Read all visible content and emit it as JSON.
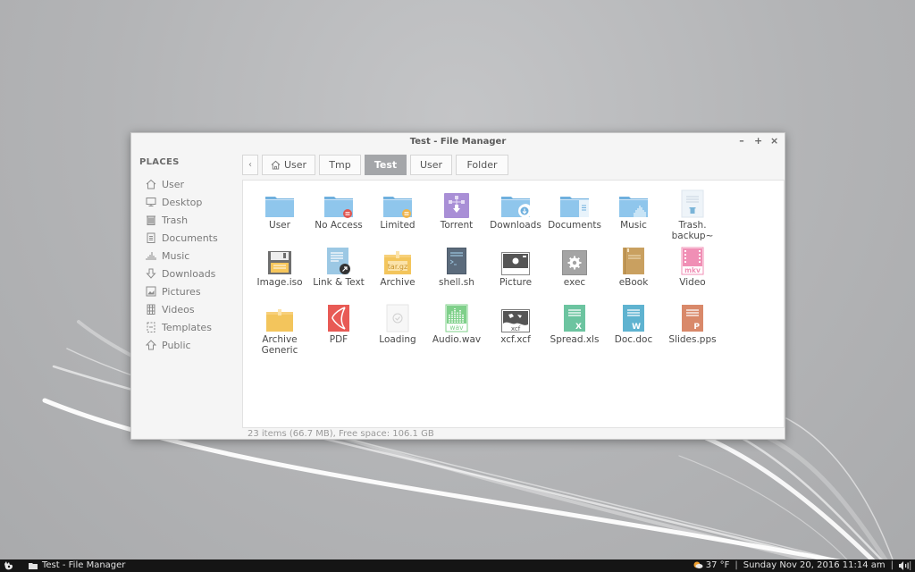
{
  "window": {
    "title": "Test - File Manager",
    "controls": {
      "minimize": "–",
      "maximize": "+",
      "close": "×"
    }
  },
  "sidebar": {
    "heading": "PLACES",
    "items": [
      {
        "label": "User",
        "icon": "home-icon"
      },
      {
        "label": "Desktop",
        "icon": "desktop-icon"
      },
      {
        "label": "Trash",
        "icon": "trash-icon"
      },
      {
        "label": "Documents",
        "icon": "documents-icon"
      },
      {
        "label": "Music",
        "icon": "music-icon"
      },
      {
        "label": "Downloads",
        "icon": "downloads-icon"
      },
      {
        "label": "Pictures",
        "icon": "pictures-icon"
      },
      {
        "label": "Videos",
        "icon": "videos-icon"
      },
      {
        "label": "Templates",
        "icon": "templates-icon"
      },
      {
        "label": "Public",
        "icon": "public-icon"
      }
    ]
  },
  "pathbar": {
    "back_label": "‹",
    "crumbs": [
      {
        "label": "User",
        "has_home_icon": true,
        "active": false
      },
      {
        "label": "Tmp",
        "active": false
      },
      {
        "label": "Test",
        "active": true
      },
      {
        "label": "User",
        "active": false
      },
      {
        "label": "Folder",
        "active": false
      }
    ]
  },
  "files": [
    {
      "name": "User",
      "type": "folder"
    },
    {
      "name": "No Access",
      "type": "folder-noaccess"
    },
    {
      "name": "Limited",
      "type": "folder-limited"
    },
    {
      "name": "Torrent",
      "type": "torrent"
    },
    {
      "name": "Downloads",
      "type": "folder-downloads"
    },
    {
      "name": "Documents",
      "type": "folder-documents"
    },
    {
      "name": "Music",
      "type": "folder-music"
    },
    {
      "name": "Trash.\nbackup~",
      "type": "backup"
    },
    {
      "name": "Image.iso",
      "type": "iso"
    },
    {
      "name": "Link & Text",
      "type": "text-link"
    },
    {
      "name": "Archive",
      "type": "archive-targz",
      "badge": "tar.gz"
    },
    {
      "name": "shell.sh",
      "type": "shell"
    },
    {
      "name": "Picture",
      "type": "picture"
    },
    {
      "name": "exec",
      "type": "exec"
    },
    {
      "name": "eBook",
      "type": "ebook"
    },
    {
      "name": "Video",
      "type": "video",
      "badge": "mkv"
    },
    {
      "name": "Archive\nGeneric",
      "type": "archive-generic"
    },
    {
      "name": "PDF",
      "type": "pdf"
    },
    {
      "name": "Loading",
      "type": "loading"
    },
    {
      "name": "Audio.wav",
      "type": "audio",
      "badge": "wav"
    },
    {
      "name": "xcf.xcf",
      "type": "xcf",
      "badge": "xcf"
    },
    {
      "name": "Spread.xls",
      "type": "spreadsheet",
      "badge": "X"
    },
    {
      "name": "Doc.doc",
      "type": "document",
      "badge": "W"
    },
    {
      "name": "Slides.pps",
      "type": "presentation",
      "badge": "P"
    }
  ],
  "status": "23 items (66.7 MB), Free space: 106.1 GB",
  "taskbar": {
    "task_title": "Test - File Manager",
    "weather": "37 °F",
    "datetime": "Sunday Nov 20, 2016 11:14 am",
    "separator": "|"
  },
  "colors": {
    "folder": "#8fc6ec",
    "folder_dark": "#6fb0de",
    "accent_active_crumb": "#a4a6a9",
    "noaccess_badge": "#e0554f",
    "limited_badge": "#f0b44a",
    "torrent": "#a98fd6",
    "archive": "#f3c55c",
    "ebook": "#c9a060",
    "video": "#f08fb5",
    "audio": "#7fd08a",
    "pdf": "#e85a55",
    "spreadsheet": "#6cc4a0",
    "document": "#5fb3d0",
    "presentation": "#d9896a"
  }
}
